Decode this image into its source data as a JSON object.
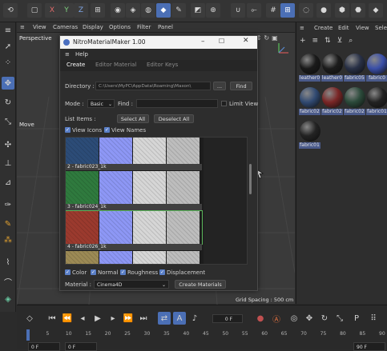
{
  "toolbar": {
    "axis_x": "X",
    "axis_y": "Y",
    "axis_z": "Z"
  },
  "viewport": {
    "menu": [
      "View",
      "Cameras",
      "Display",
      "Options",
      "Filter",
      "Panel"
    ],
    "label": "Perspective",
    "move_label": "Move",
    "grid_spacing": "Grid Spacing : 500 cm"
  },
  "right_panel": {
    "menu": [
      "Create",
      "Edit",
      "View",
      "Selec"
    ],
    "materials": [
      {
        "label": "leather0",
        "color": "#1a1a1a"
      },
      {
        "label": "leather0",
        "color": "#1c1c1c"
      },
      {
        "label": "fabric05",
        "color": "#283046"
      },
      {
        "label": "fabric0",
        "color": "#3a4fa8"
      },
      {
        "label": "fabric02",
        "color": "#314a72"
      },
      {
        "label": "fabric02",
        "color": "#7a2626"
      },
      {
        "label": "fabric02",
        "color": "#2b4a3a"
      },
      {
        "label": "fabric01",
        "color": "#222222"
      },
      {
        "label": "fabric01",
        "color": "#232323"
      }
    ]
  },
  "dialog": {
    "title": "NitroMaterialMaker 1.00",
    "menu_help": "Help",
    "tabs": [
      "Create",
      "Editor Material",
      "Editor Keys"
    ],
    "directory_label": "Directory :",
    "directory_value": "C:\\Users\\MyPC\\AppData\\Roaming\\Maxon\\",
    "browse_button": "...",
    "find_button": "Find",
    "mode_label": "Mode :",
    "mode_value": "Basic",
    "find_label": "Find :",
    "find_value": "",
    "limit_view_label": "Limit View",
    "list_items_label": "List Items :",
    "select_all_button": "Select All",
    "deselect_all_button": "Deselect All",
    "view_icons_label": "View Icons",
    "view_names_label": "View Names",
    "rows": [
      {
        "label": "2 - fabric023_1k",
        "base": "#2c4c77"
      },
      {
        "label": "3 - fabric024_1k",
        "base": "#2f7a3e"
      },
      {
        "label": "4 - fabric026_1k",
        "base": "#9b3a2e"
      },
      {
        "label": "",
        "base": "#9c8a55"
      }
    ],
    "map_colors": {
      "normal": "#8d97f5",
      "roughness": "#d6d6d6",
      "displacement": "#bdbdbd"
    },
    "checks": [
      "Color",
      "Normal",
      "Roughness",
      "Displacement"
    ],
    "material_label": "Material :",
    "material_value": "Cinema4D",
    "create_button": "Create Materials"
  },
  "timeline": {
    "current_frame": "0 F",
    "start_frame": "0 F",
    "end_frame": "90 F",
    "ruler": [
      "0",
      "5",
      "10",
      "15",
      "20",
      "25",
      "30",
      "35",
      "40",
      "45",
      "50",
      "55",
      "60",
      "65",
      "70",
      "75",
      "80",
      "85",
      "90"
    ]
  }
}
